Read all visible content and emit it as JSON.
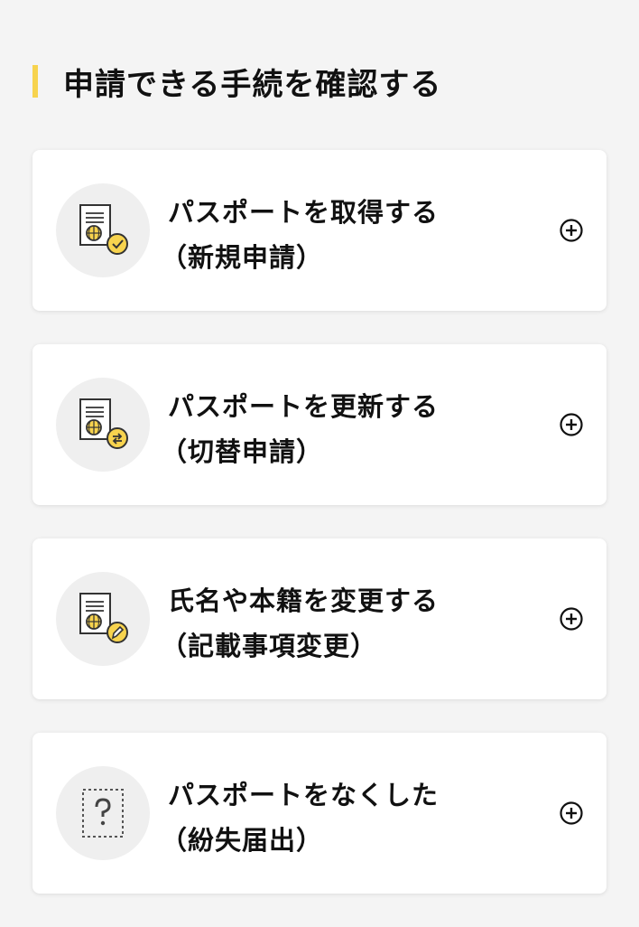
{
  "section": {
    "title": "申請できる手続を確認する",
    "accent_color": "#f7d34e"
  },
  "cards": [
    {
      "title": "パスポートを取得する",
      "subtitle": "（新規申請）",
      "icon": "passport-check-icon",
      "action_icon": "plus-circle-icon"
    },
    {
      "title": "パスポートを更新する",
      "subtitle": "（切替申請）",
      "icon": "passport-renew-icon",
      "action_icon": "plus-circle-icon"
    },
    {
      "title": "氏名や本籍を変更する",
      "subtitle": "（記載事項変更）",
      "icon": "passport-edit-icon",
      "action_icon": "plus-circle-icon"
    },
    {
      "title": "パスポートをなくした",
      "subtitle": "（紛失届出）",
      "icon": "lost-document-question-icon",
      "action_icon": "plus-circle-icon"
    }
  ]
}
